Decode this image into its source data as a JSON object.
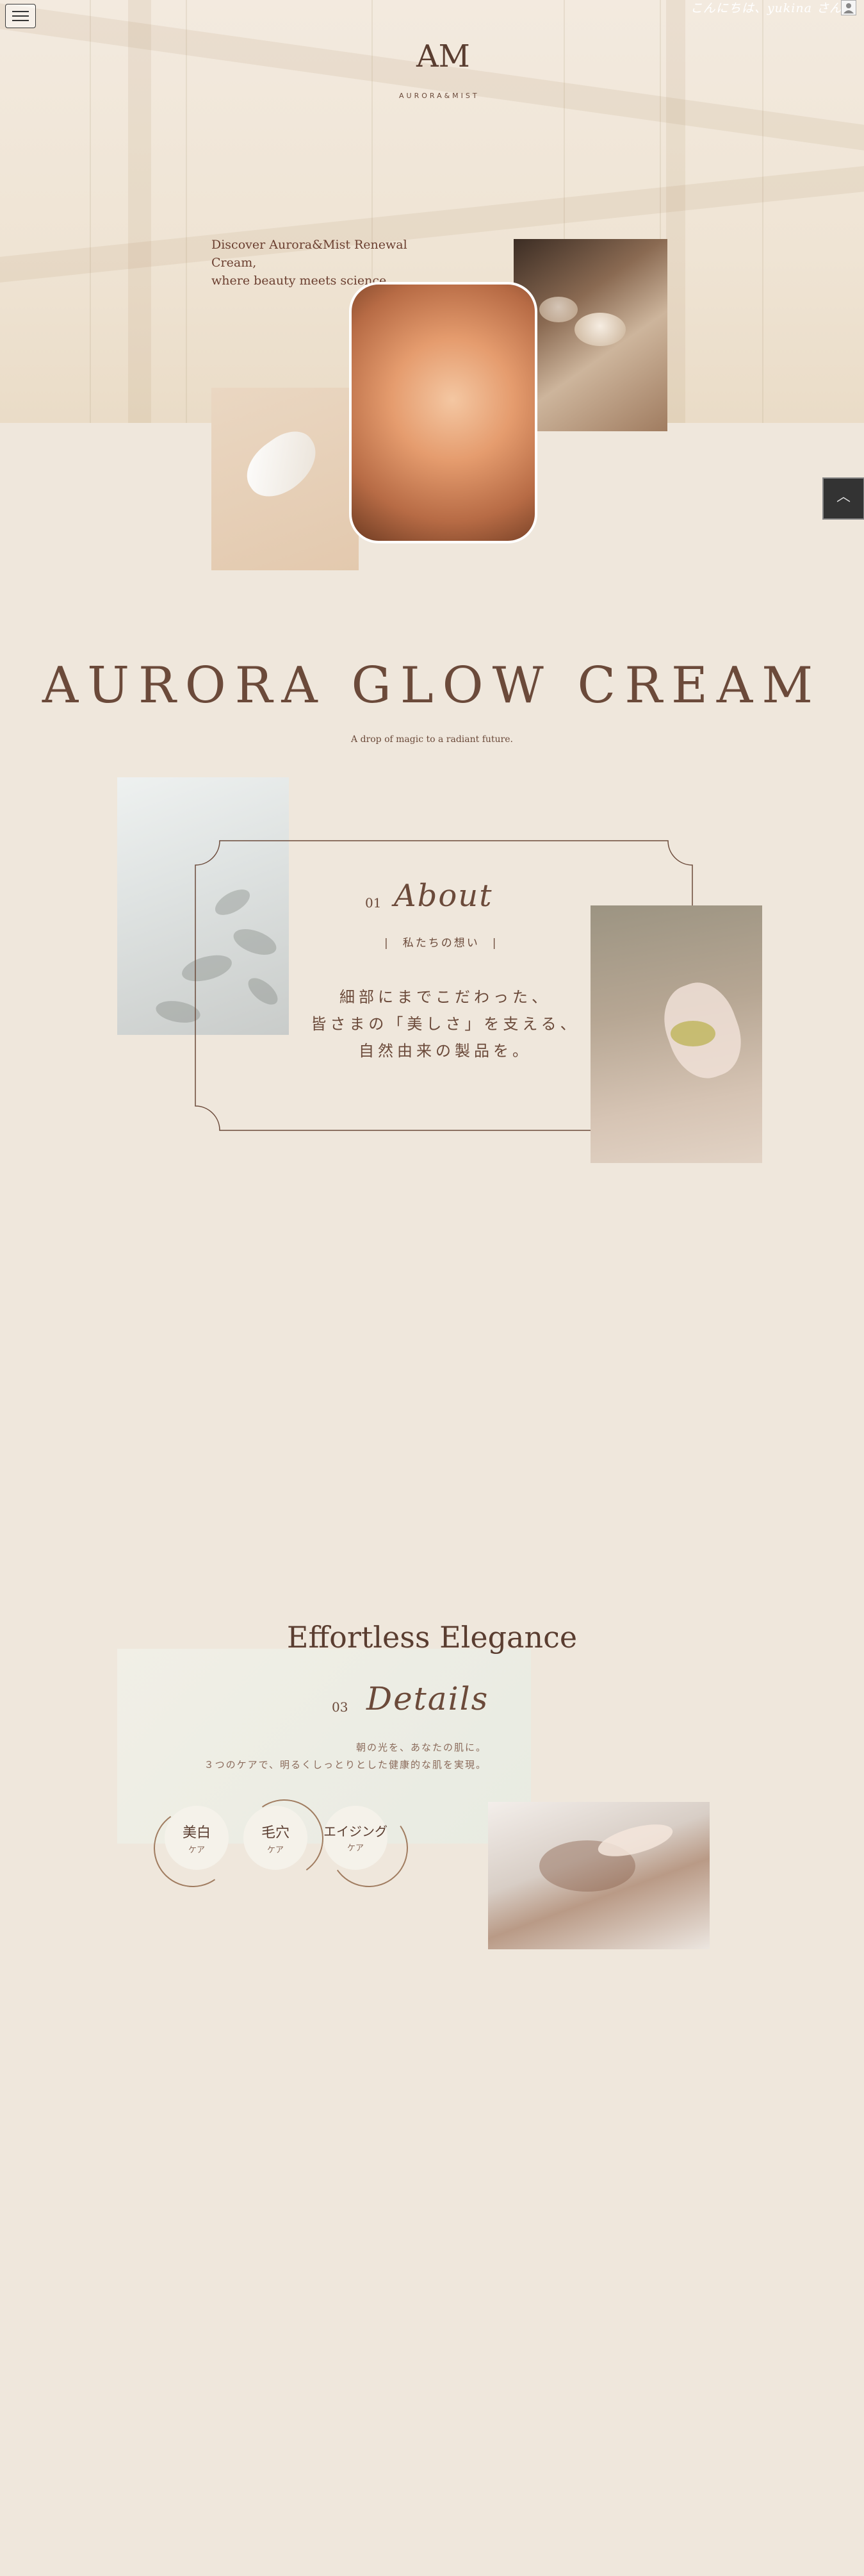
{
  "header": {
    "greeting": "こんにちは、yukina さん",
    "logo_mark": "AM",
    "logo_text": "AURORA&MIST",
    "menu_icon": "hamburger-icon",
    "avatar_icon": "user-icon"
  },
  "hero": {
    "tagline_line1": "Discover Aurora&Mist Renewal Cream,",
    "tagline_line2": "where beauty meets science."
  },
  "to_top": {
    "icon": "chevron-up-icon",
    "glyph": "︿"
  },
  "glow": {
    "title": "AURORA GLOW CREAM",
    "subtitle": "A drop of magic to a radiant future."
  },
  "about": {
    "number": "01",
    "script": "About",
    "sub": "|　私たちの想い　|",
    "body_line1": "細部にまでこだわった、",
    "body_line2": "皆さまの「美しさ」を支える、",
    "body_line3": "自然由来の製品を。"
  },
  "details": {
    "title": "Effortless Elegance",
    "number": "03",
    "script": "Details",
    "body_line1": "朝の光を、あなたの肌に。",
    "body_line2": "３つのケアで、明るくしっとりとした健康的な肌を実現。",
    "cares": [
      {
        "main": "美白",
        "sub": "ケア"
      },
      {
        "main": "毛穴",
        "sub": "ケア"
      },
      {
        "main": "エイジング",
        "sub": "ケア"
      }
    ]
  },
  "colors": {
    "background": "#efe7dc",
    "accent": "#6b4a3a"
  }
}
